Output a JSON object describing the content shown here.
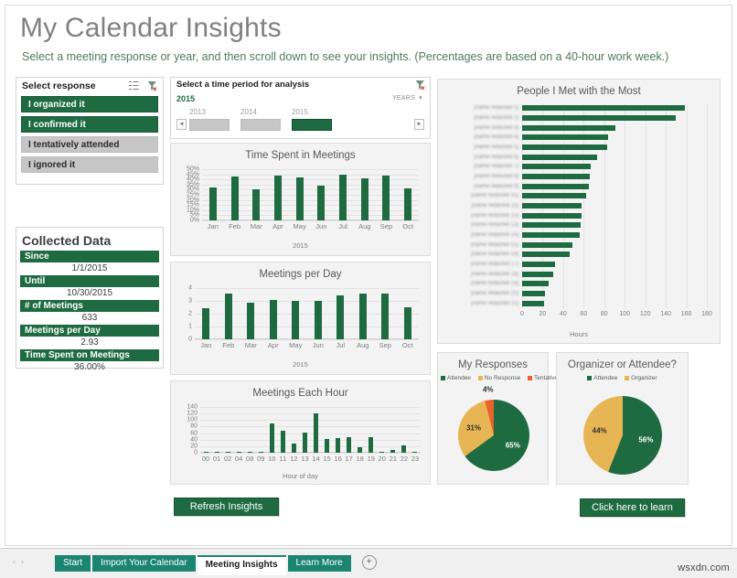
{
  "header": {
    "title": "My Calendar Insights",
    "subtitle": "Select a meeting response or year, and then scroll down to see your insights. (Percentages are based on a 40-hour work week.)"
  },
  "response_slicer": {
    "caption": "Select response",
    "multiselect_icon": "multi-select-icon",
    "clear_filter_icon": "clear-filter-icon",
    "items": [
      {
        "label": "I organized it",
        "selected": true
      },
      {
        "label": "I confirmed it",
        "selected": true
      },
      {
        "label": "I tentatively attended",
        "selected": false
      },
      {
        "label": "I ignored it",
        "selected": false
      }
    ]
  },
  "timeline_slicer": {
    "caption": "Select a time period for analysis",
    "clear_filter_icon": "clear-filter-icon",
    "selected_label": "2015",
    "units_label": "YEARS",
    "units_caret": "▾",
    "left_arrow": "◄",
    "right_arrow": "►",
    "years": [
      {
        "label": "2013",
        "selected": false
      },
      {
        "label": "2014",
        "selected": false
      },
      {
        "label": "2015",
        "selected": true
      }
    ]
  },
  "collected_data": {
    "title": "Collected Data",
    "rows": [
      {
        "label": "Since",
        "value": "1/1/2015"
      },
      {
        "label": "Until",
        "value": "10/30/2015"
      },
      {
        "label": "# of Meetings",
        "value": "633"
      },
      {
        "label": "Meetings per Day",
        "value": "2.93"
      },
      {
        "label": "Time Spent on Meetings",
        "value": "36.00%"
      }
    ]
  },
  "buttons": {
    "refresh": "Refresh Insights",
    "learn_more": "Click here to learn more"
  },
  "tabbar": {
    "nav_prev": "‹",
    "nav_next": "›",
    "add_sheet_icon": "add-sheet-icon",
    "add_sheet_label": "+",
    "tabs": [
      {
        "label": "Start",
        "active": false
      },
      {
        "label": "Import Your Calendar",
        "active": false
      },
      {
        "label": "Meeting Insights",
        "active": true
      },
      {
        "label": "Learn More",
        "active": false
      }
    ]
  },
  "watermark": "wsxdn.com",
  "colors": {
    "green": "#1e6b41",
    "gold": "#e8b554",
    "orange": "#e8622a",
    "gray": "#c6c6c6",
    "teal_tab": "#1b8572",
    "title_gray": "#808080",
    "subtitle_green": "#4e7a5c"
  },
  "chart_data": [
    {
      "id": "time_spent",
      "type": "bar",
      "title": "Time Spent in Meetings",
      "xlabel": "2015",
      "ylabel": "",
      "categories": [
        "Jan",
        "Feb",
        "Mar",
        "Apr",
        "May",
        "Jun",
        "Jul",
        "Aug",
        "Sep",
        "Oct"
      ],
      "values": [
        32,
        43,
        30,
        44,
        42,
        34,
        45,
        41,
        44,
        31
      ],
      "ylim": [
        0,
        50
      ],
      "yticks": [
        "0%",
        "5%",
        "10%",
        "15%",
        "20%",
        "25%",
        "30%",
        "35%",
        "40%",
        "45%",
        "50%"
      ],
      "ytick_values": [
        0,
        5,
        10,
        15,
        20,
        25,
        30,
        35,
        40,
        45,
        50
      ],
      "grid": true,
      "legend": "none"
    },
    {
      "id": "meetings_per_day",
      "type": "bar",
      "title": "Meetings per Day",
      "xlabel": "2015",
      "ylabel": "",
      "categories": [
        "Jan",
        "Feb",
        "Mar",
        "Apr",
        "May",
        "Jun",
        "Jul",
        "Aug",
        "Sep",
        "Oct"
      ],
      "values": [
        2.4,
        3.6,
        2.85,
        3.1,
        3.03,
        2.98,
        3.4,
        3.6,
        3.6,
        2.53
      ],
      "ylim": [
        0,
        4
      ],
      "yticks": [
        "0",
        "1",
        "2",
        "3",
        "4"
      ],
      "ytick_values": [
        0,
        1,
        2,
        3,
        4
      ],
      "grid": true,
      "legend": "none"
    },
    {
      "id": "meetings_each_hour",
      "type": "bar",
      "title": "Meetings Each Hour",
      "xlabel": "Hour of day",
      "ylabel": "",
      "categories": [
        "00",
        "01",
        "02",
        "04",
        "08",
        "09",
        "10",
        "11",
        "12",
        "13",
        "14",
        "15",
        "16",
        "17",
        "18",
        "19",
        "20",
        "21",
        "22",
        "23"
      ],
      "values": [
        1,
        4,
        1,
        1,
        1,
        1,
        89,
        67,
        27,
        61,
        120,
        43,
        46,
        48,
        16,
        49,
        1,
        8,
        23,
        4
      ],
      "ylim": [
        0,
        140
      ],
      "yticks": [
        "0",
        "20",
        "40",
        "60",
        "80",
        "100",
        "120",
        "140"
      ],
      "ytick_values": [
        0,
        20,
        40,
        60,
        80,
        100,
        120,
        140
      ],
      "grid": true,
      "legend": "none"
    },
    {
      "id": "people_met",
      "type": "bar",
      "orientation": "horizontal",
      "title": "People I Met with the Most",
      "xlabel": "Hours",
      "ylabel": "",
      "categories": [
        "[name redacted 1]",
        "[name redacted 2]",
        "[name redacted 3]",
        "[name redacted 4]",
        "[name redacted 5]",
        "[name redacted 6]",
        "[name redacted 7]",
        "[name redacted 8]",
        "[name redacted 9]",
        "[name redacted 10]",
        "[name redacted 11]",
        "[name redacted 12]",
        "[name redacted 13]",
        "[name redacted 14]",
        "[name redacted 15]",
        "[name redacted 16]",
        "[name redacted 17]",
        "[name redacted 18]",
        "[name redacted 19]",
        "[name redacted 20]",
        "[name redacted 21]"
      ],
      "values": [
        159,
        150,
        91,
        84,
        83,
        73,
        67,
        66,
        65,
        62,
        58,
        58,
        57,
        56,
        49,
        46,
        32,
        30,
        26,
        22,
        21
      ],
      "xlim": [
        0,
        180
      ],
      "xticks": [
        "0",
        "20",
        "40",
        "60",
        "80",
        "100",
        "120",
        "140",
        "160",
        "180"
      ],
      "xtick_values": [
        0,
        20,
        40,
        60,
        80,
        100,
        120,
        140,
        160,
        180
      ],
      "grid": true,
      "legend": "none"
    },
    {
      "id": "my_responses",
      "type": "pie",
      "title": "My Responses",
      "legend_position": "top",
      "labels": [
        "Attendee",
        "No Response",
        "Tentative"
      ],
      "values": [
        65,
        31,
        4
      ],
      "value_labels": [
        "65%",
        "31%",
        "4%"
      ],
      "colors": [
        "#1e6b41",
        "#e8b554",
        "#e8622a"
      ]
    },
    {
      "id": "organizer_or_attendee",
      "type": "pie",
      "title": "Organizer or Attendee?",
      "legend_position": "top",
      "labels": [
        "Attendee",
        "Organizer"
      ],
      "values": [
        56,
        44
      ],
      "value_labels": [
        "56%",
        "44%"
      ],
      "colors": [
        "#1e6b41",
        "#e8b554"
      ]
    }
  ]
}
